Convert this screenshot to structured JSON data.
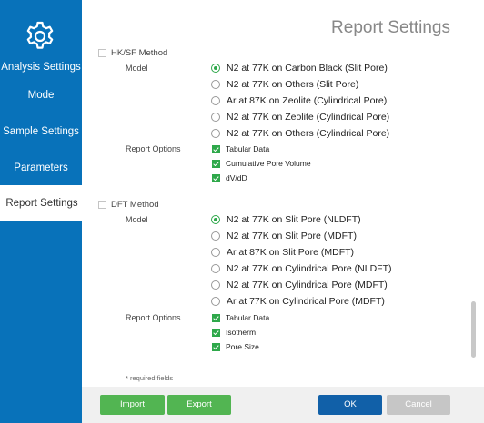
{
  "window": {
    "title": "Report Settings"
  },
  "sidebar": {
    "items": [
      {
        "label": "Analysis Settings"
      },
      {
        "label": "Mode"
      },
      {
        "label": "Sample Settings"
      },
      {
        "label": "Parameters"
      },
      {
        "label": "Report Settings"
      }
    ]
  },
  "hksf": {
    "header": "HK/SF Method",
    "model_label": "Model",
    "models": [
      {
        "label": "N2 at 77K on Carbon Black (Slit Pore)"
      },
      {
        "label": "N2 at 77K on Others (Slit Pore)"
      },
      {
        "label": "Ar at 87K on Zeolite (Cylindrical Pore)"
      },
      {
        "label": "N2 at 77K on Zeolite (Cylindrical Pore)"
      },
      {
        "label": "N2 at 77K on Others (Cylindrical Pore)"
      }
    ],
    "options_label": "Report Options",
    "options": [
      {
        "label": "Tabular Data"
      },
      {
        "label": "Cumulative Pore Volume"
      },
      {
        "label": "dV/dD"
      }
    ]
  },
  "dft": {
    "header": "DFT Method",
    "model_label": "Model",
    "models": [
      {
        "label": "N2 at 77K on Slit Pore (NLDFT)"
      },
      {
        "label": "N2 at 77K on Slit Pore (MDFT)"
      },
      {
        "label": "Ar at 87K on Slit Pore (MDFT)"
      },
      {
        "label": "N2 at 77K on Cylindrical Pore (NLDFT)"
      },
      {
        "label": "N2 at 77K on Cylindrical Pore (MDFT)"
      },
      {
        "label": "Ar at 77K on Cylindrical Pore (MDFT)"
      }
    ],
    "options_label": "Report Options",
    "options": [
      {
        "label": "Tabular Data"
      },
      {
        "label": "Isotherm"
      },
      {
        "label": "Pore Size"
      }
    ]
  },
  "required_note": "* required fields",
  "buttons": {
    "import": "Import",
    "export": "Export",
    "ok": "OK",
    "cancel": "Cancel"
  },
  "colors": {
    "sidebar": "#0872ba",
    "accent_green": "#2ea84a",
    "ok_blue": "#1160a8",
    "button_green": "#52b552",
    "cancel_gray": "#c6c6c6"
  }
}
